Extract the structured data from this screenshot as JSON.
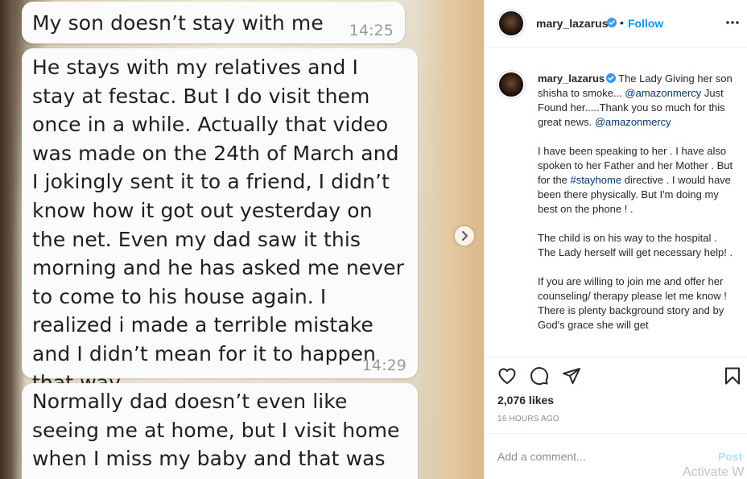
{
  "photo": {
    "messages": [
      {
        "text": "My son doesn’t stay with me",
        "time": "14:25"
      },
      {
        "text": "He stays with my relatives and I stay at festac. But I do visit them once in a while. Actually that video was made on the 24th of March and I jokingly sent it to a friend, I didn’t know how it got out yesterday on the net. Even my dad saw it this morning and he has asked me never to come to his house again. I realized i made a terrible mistake and I didn’t mean for it to happen that way.",
        "time": "14:29"
      },
      {
        "text": "Normally dad doesn’t even like seeing me at home, but I visit home when I miss my baby and that was",
        "time": ""
      }
    ],
    "next_icon": "chevron-right-icon"
  },
  "header": {
    "username": "mary_lazarus",
    "separator": "•",
    "follow_label": "Follow",
    "more_icon": "more-horizontal-icon"
  },
  "caption": {
    "username": "mary_lazarus",
    "line1_text": "The Lady Giving her son shisha to smoke... ",
    "mention1": "@amazonmercy",
    "line1_tail": " Just Found her.....Thank you so much for this great news. ",
    "mention2": "@amazonmercy",
    "para2_a": "I have been speaking to her . I have also spoken to her Father and her Mother . But for the ",
    "hashtag": "#stayhome",
    "para2_b": " directive . I would have been there physically. But I'm doing my best on the phone ! .",
    "para3": "The child is on his way to the hospital . The Lady herself will get necessary help! .",
    "para4": "If you are willing to join me and offer her counseling/ therapy please let me know ! There is plenty background story and by God's grace she will get"
  },
  "actions": {
    "like_icon": "heart-icon",
    "comment_icon": "comment-icon",
    "share_icon": "send-icon",
    "save_icon": "bookmark-icon"
  },
  "likes_text": "2,076 likes",
  "time_ago": "16 HOURS AGO",
  "comment": {
    "placeholder": "Add a comment...",
    "post_label": "Post"
  },
  "watermark": "Activate W",
  "colors": {
    "link_blue": "#0095f6",
    "mention_blue": "#00376b",
    "post_disabled": "#b2dffc",
    "verified_blue": "#3897f0"
  }
}
